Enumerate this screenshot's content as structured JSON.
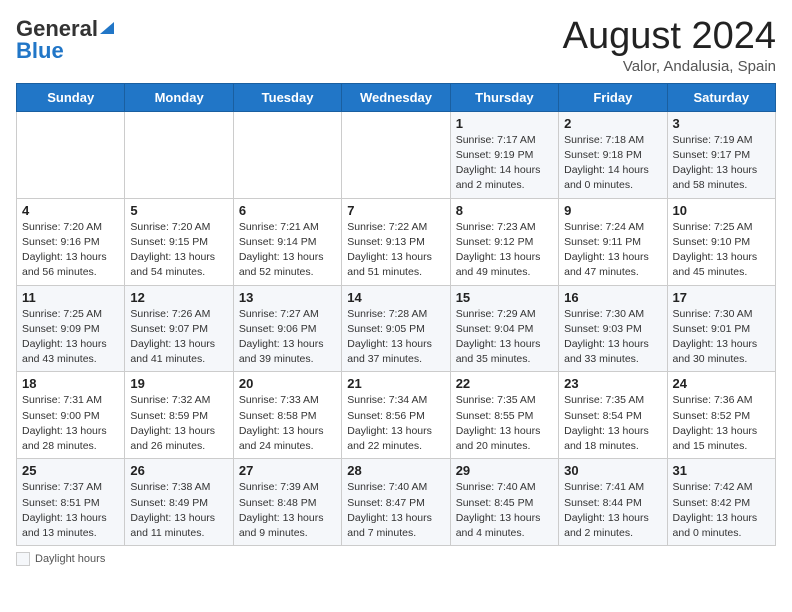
{
  "header": {
    "logo_general": "General",
    "logo_blue": "Blue",
    "month_year": "August 2024",
    "location": "Valor, Andalusia, Spain"
  },
  "days_of_week": [
    "Sunday",
    "Monday",
    "Tuesday",
    "Wednesday",
    "Thursday",
    "Friday",
    "Saturday"
  ],
  "weeks": [
    [
      {
        "day": "",
        "info": ""
      },
      {
        "day": "",
        "info": ""
      },
      {
        "day": "",
        "info": ""
      },
      {
        "day": "",
        "info": ""
      },
      {
        "day": "1",
        "info": "Sunrise: 7:17 AM\nSunset: 9:19 PM\nDaylight: 14 hours\nand 2 minutes."
      },
      {
        "day": "2",
        "info": "Sunrise: 7:18 AM\nSunset: 9:18 PM\nDaylight: 14 hours\nand 0 minutes."
      },
      {
        "day": "3",
        "info": "Sunrise: 7:19 AM\nSunset: 9:17 PM\nDaylight: 13 hours\nand 58 minutes."
      }
    ],
    [
      {
        "day": "4",
        "info": "Sunrise: 7:20 AM\nSunset: 9:16 PM\nDaylight: 13 hours\nand 56 minutes."
      },
      {
        "day": "5",
        "info": "Sunrise: 7:20 AM\nSunset: 9:15 PM\nDaylight: 13 hours\nand 54 minutes."
      },
      {
        "day": "6",
        "info": "Sunrise: 7:21 AM\nSunset: 9:14 PM\nDaylight: 13 hours\nand 52 minutes."
      },
      {
        "day": "7",
        "info": "Sunrise: 7:22 AM\nSunset: 9:13 PM\nDaylight: 13 hours\nand 51 minutes."
      },
      {
        "day": "8",
        "info": "Sunrise: 7:23 AM\nSunset: 9:12 PM\nDaylight: 13 hours\nand 49 minutes."
      },
      {
        "day": "9",
        "info": "Sunrise: 7:24 AM\nSunset: 9:11 PM\nDaylight: 13 hours\nand 47 minutes."
      },
      {
        "day": "10",
        "info": "Sunrise: 7:25 AM\nSunset: 9:10 PM\nDaylight: 13 hours\nand 45 minutes."
      }
    ],
    [
      {
        "day": "11",
        "info": "Sunrise: 7:25 AM\nSunset: 9:09 PM\nDaylight: 13 hours\nand 43 minutes."
      },
      {
        "day": "12",
        "info": "Sunrise: 7:26 AM\nSunset: 9:07 PM\nDaylight: 13 hours\nand 41 minutes."
      },
      {
        "day": "13",
        "info": "Sunrise: 7:27 AM\nSunset: 9:06 PM\nDaylight: 13 hours\nand 39 minutes."
      },
      {
        "day": "14",
        "info": "Sunrise: 7:28 AM\nSunset: 9:05 PM\nDaylight: 13 hours\nand 37 minutes."
      },
      {
        "day": "15",
        "info": "Sunrise: 7:29 AM\nSunset: 9:04 PM\nDaylight: 13 hours\nand 35 minutes."
      },
      {
        "day": "16",
        "info": "Sunrise: 7:30 AM\nSunset: 9:03 PM\nDaylight: 13 hours\nand 33 minutes."
      },
      {
        "day": "17",
        "info": "Sunrise: 7:30 AM\nSunset: 9:01 PM\nDaylight: 13 hours\nand 30 minutes."
      }
    ],
    [
      {
        "day": "18",
        "info": "Sunrise: 7:31 AM\nSunset: 9:00 PM\nDaylight: 13 hours\nand 28 minutes."
      },
      {
        "day": "19",
        "info": "Sunrise: 7:32 AM\nSunset: 8:59 PM\nDaylight: 13 hours\nand 26 minutes."
      },
      {
        "day": "20",
        "info": "Sunrise: 7:33 AM\nSunset: 8:58 PM\nDaylight: 13 hours\nand 24 minutes."
      },
      {
        "day": "21",
        "info": "Sunrise: 7:34 AM\nSunset: 8:56 PM\nDaylight: 13 hours\nand 22 minutes."
      },
      {
        "day": "22",
        "info": "Sunrise: 7:35 AM\nSunset: 8:55 PM\nDaylight: 13 hours\nand 20 minutes."
      },
      {
        "day": "23",
        "info": "Sunrise: 7:35 AM\nSunset: 8:54 PM\nDaylight: 13 hours\nand 18 minutes."
      },
      {
        "day": "24",
        "info": "Sunrise: 7:36 AM\nSunset: 8:52 PM\nDaylight: 13 hours\nand 15 minutes."
      }
    ],
    [
      {
        "day": "25",
        "info": "Sunrise: 7:37 AM\nSunset: 8:51 PM\nDaylight: 13 hours\nand 13 minutes."
      },
      {
        "day": "26",
        "info": "Sunrise: 7:38 AM\nSunset: 8:49 PM\nDaylight: 13 hours\nand 11 minutes."
      },
      {
        "day": "27",
        "info": "Sunrise: 7:39 AM\nSunset: 8:48 PM\nDaylight: 13 hours\nand 9 minutes."
      },
      {
        "day": "28",
        "info": "Sunrise: 7:40 AM\nSunset: 8:47 PM\nDaylight: 13 hours\nand 7 minutes."
      },
      {
        "day": "29",
        "info": "Sunrise: 7:40 AM\nSunset: 8:45 PM\nDaylight: 13 hours\nand 4 minutes."
      },
      {
        "day": "30",
        "info": "Sunrise: 7:41 AM\nSunset: 8:44 PM\nDaylight: 13 hours\nand 2 minutes."
      },
      {
        "day": "31",
        "info": "Sunrise: 7:42 AM\nSunset: 8:42 PM\nDaylight: 13 hours\nand 0 minutes."
      }
    ]
  ],
  "legend": {
    "label": "Daylight hours"
  }
}
